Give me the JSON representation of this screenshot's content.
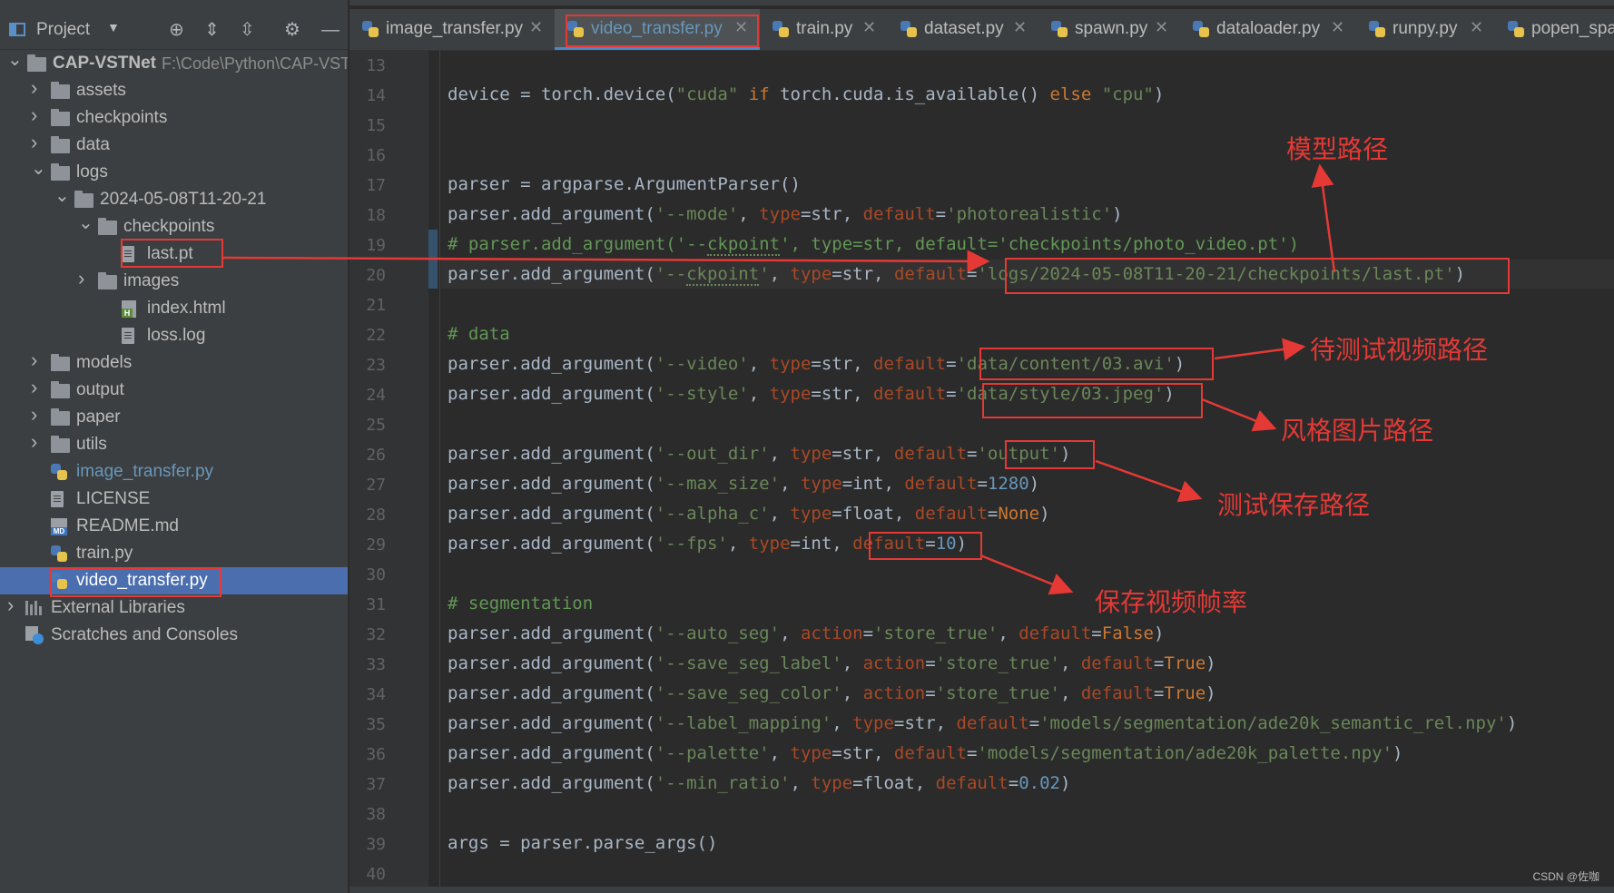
{
  "sidebar": {
    "title": "Project",
    "root": {
      "name": "CAP-VSTNet",
      "path": "F:\\Code\\Python\\CAP-VSTNet"
    },
    "tree": [
      {
        "label": "assets",
        "type": "folder"
      },
      {
        "label": "checkpoints",
        "type": "folder"
      },
      {
        "label": "data",
        "type": "folder"
      },
      {
        "label": "logs",
        "type": "folder",
        "expanded": true
      },
      {
        "label": "2024-05-08T11-20-21",
        "type": "folder",
        "expanded": true
      },
      {
        "label": "checkpoints",
        "type": "folder",
        "expanded": true
      },
      {
        "label": "last.pt",
        "type": "file"
      },
      {
        "label": "images",
        "type": "folder"
      },
      {
        "label": "index.html",
        "type": "html"
      },
      {
        "label": "loss.log",
        "type": "file"
      },
      {
        "label": "models",
        "type": "folder"
      },
      {
        "label": "output",
        "type": "folder"
      },
      {
        "label": "paper",
        "type": "folder"
      },
      {
        "label": "utils",
        "type": "folder"
      },
      {
        "label": "image_transfer.py",
        "type": "py"
      },
      {
        "label": "LICENSE",
        "type": "file"
      },
      {
        "label": "README.md",
        "type": "md"
      },
      {
        "label": "train.py",
        "type": "py"
      },
      {
        "label": "video_transfer.py",
        "type": "py",
        "selected": true
      },
      {
        "label": "External Libraries",
        "type": "lib"
      },
      {
        "label": "Scratches and Consoles",
        "type": "scratch"
      }
    ]
  },
  "tabs": [
    {
      "label": "image_transfer.py"
    },
    {
      "label": "video_transfer.py",
      "active": true
    },
    {
      "label": "train.py"
    },
    {
      "label": "dataset.py"
    },
    {
      "label": "spawn.py"
    },
    {
      "label": "dataloader.py"
    },
    {
      "label": "runpy.py"
    },
    {
      "label": "popen_spa"
    }
  ],
  "editor": {
    "first_line": 13,
    "current_line": 20,
    "lines": [
      "",
      "device = torch.device(\"cuda\" if torch.cuda.is_available() else \"cpu\")",
      "",
      "",
      "parser = argparse.ArgumentParser()",
      "parser.add_argument('--mode', type=str, default='photorealistic')",
      "# parser.add_argument('--ckpoint', type=str, default='checkpoints/photo_video.pt')",
      "parser.add_argument('--ckpoint', type=str, default='logs/2024-05-08T11-20-21/checkpoints/last.pt')",
      "",
      "# data",
      "parser.add_argument('--video', type=str, default='data/content/03.avi')",
      "parser.add_argument('--style', type=str, default='data/style/03.jpeg')",
      "",
      "parser.add_argument('--out_dir', type=str, default='output')",
      "parser.add_argument('--max_size', type=int, default=1280)",
      "parser.add_argument('--alpha_c', type=float, default=None)",
      "parser.add_argument('--fps', type=int, default=10)",
      "",
      "# segmentation",
      "parser.add_argument('--auto_seg', action='store_true', default=False)",
      "parser.add_argument('--save_seg_label', action='store_true', default=True)",
      "parser.add_argument('--save_seg_color', action='store_true', default=True)",
      "parser.add_argument('--label_mapping', type=str, default='models/segmentation/ade20k_semantic_rel.npy')",
      "parser.add_argument('--palette', type=str, default='models/segmentation/ade20k_palette.npy')",
      "parser.add_argument('--min_ratio', type=float, default=0.02)",
      "",
      "args = parser.parse_args()",
      ""
    ]
  },
  "annotations": {
    "model_path": "模型路径",
    "video_path": "待测试视频路径",
    "style_path": "风格图片路径",
    "output_path": "测试保存路径",
    "fps": "保存视频帧率"
  },
  "watermark": "CSDN @佐咖",
  "colors": {
    "annotation": "#e53935",
    "selection": "#4b6eaf",
    "keyword": "#cc7832",
    "string": "#6a8759"
  }
}
